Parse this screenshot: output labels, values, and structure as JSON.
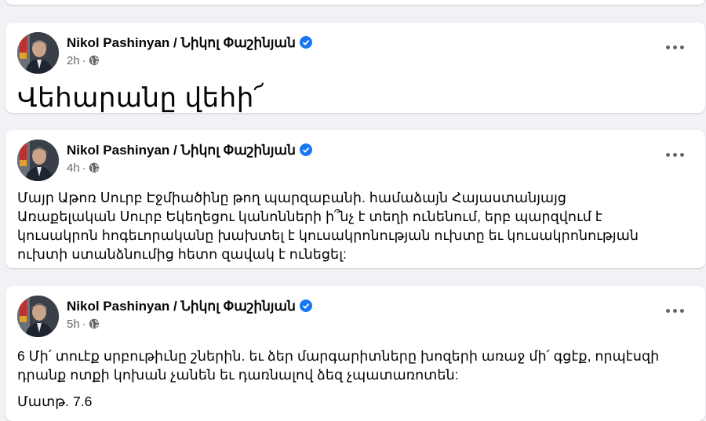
{
  "posts": [
    {
      "author": "Nikol Pashinyan / Նիկոլ Փաշինյան",
      "time": "2h",
      "separator": "·",
      "text": "Վեհարանը վեհի՜"
    },
    {
      "author": "Nikol Pashinyan / Նիկոլ Փաշինյան",
      "time": "4h",
      "separator": "·",
      "text_lines": [
        "Մայր Աթոռ Սուրբ Էջմիածինը թող պարզաբանի. համաձայն Հայաստանյայց",
        "Առաքելական Սուրբ Եկեղեցու կանոնների ի՞նչ է տեղի ունենում, երբ պարզվում է",
        "կուսակրոն հոգեւորականը խախտել է կուսակրոնության ուխտը եւ կուսակրոնության",
        "ուխտի ստանձնումից հետո զավակ է ունեցել:"
      ]
    },
    {
      "author": "Nikol Pashinyan / Նիկոլ Փաշինյան",
      "time": "5h",
      "separator": "·",
      "text_lines": [
        "6 Մի՛ տուէք սրբութիւնը շներին. եւ ձեր մարգարիտները խոզերի առաջ մի՛ գցէք, որպէսզի",
        "դրանք ոտքի կոխան չանեն եւ դառնալով ձեզ չպատառոտեն:"
      ],
      "reference": "Մատթ. 7.6"
    }
  ],
  "icons": {
    "verified": "verified-badge-icon",
    "audience": "globe-icon",
    "menu": "more-options-icon"
  },
  "colors": {
    "background": "#f0f2f5",
    "card": "#ffffff",
    "verified": "#1877f2",
    "meta": "#65676b"
  }
}
